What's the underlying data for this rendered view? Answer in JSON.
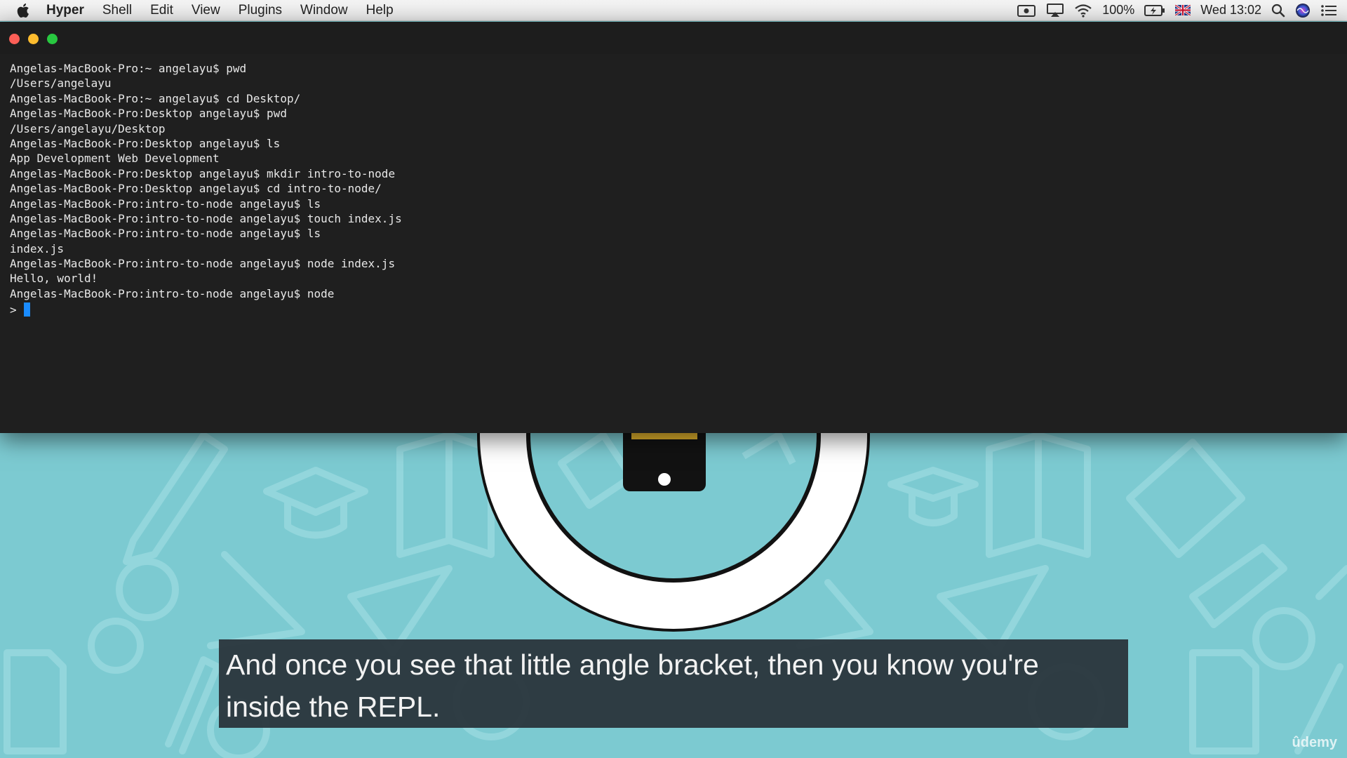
{
  "menubar": {
    "app_name": "Hyper",
    "items": [
      "Shell",
      "Edit",
      "View",
      "Plugins",
      "Window",
      "Help"
    ],
    "battery": "100%",
    "clock": "Wed 13:02"
  },
  "terminal": {
    "lines": [
      "Angelas-MacBook-Pro:~ angelayu$ pwd",
      "/Users/angelayu",
      "Angelas-MacBook-Pro:~ angelayu$ cd Desktop/",
      "Angelas-MacBook-Pro:Desktop angelayu$ pwd",
      "/Users/angelayu/Desktop",
      "Angelas-MacBook-Pro:Desktop angelayu$ ls",
      "App Development Web Development",
      "Angelas-MacBook-Pro:Desktop angelayu$ mkdir intro-to-node",
      "Angelas-MacBook-Pro:Desktop angelayu$ cd intro-to-node/",
      "Angelas-MacBook-Pro:intro-to-node angelayu$ ls",
      "Angelas-MacBook-Pro:intro-to-node angelayu$ touch index.js",
      "Angelas-MacBook-Pro:intro-to-node angelayu$ ls",
      "index.js",
      "Angelas-MacBook-Pro:intro-to-node angelayu$ node index.js",
      "Hello, world!",
      "Angelas-MacBook-Pro:intro-to-node angelayu$ node"
    ],
    "repl_prompt": ">",
    "cursor_color": "#1a8cff"
  },
  "subtitle": {
    "line1": "And once you see that little angle bracket, then you know you're",
    "line2": "inside the REPL."
  },
  "watermark": "ûdemy",
  "colors": {
    "background": "#7ccad1",
    "terminal_bg": "#1f1f1f",
    "traffic_close": "#fc5f57",
    "traffic_min": "#fdbc2e",
    "traffic_max": "#28c840"
  },
  "icons": [
    "apple-icon",
    "screen-record-icon",
    "airplay-icon",
    "wifi-icon",
    "battery-icon",
    "uk-flag-icon",
    "spotlight-search-icon",
    "siri-icon",
    "notification-center-icon"
  ]
}
